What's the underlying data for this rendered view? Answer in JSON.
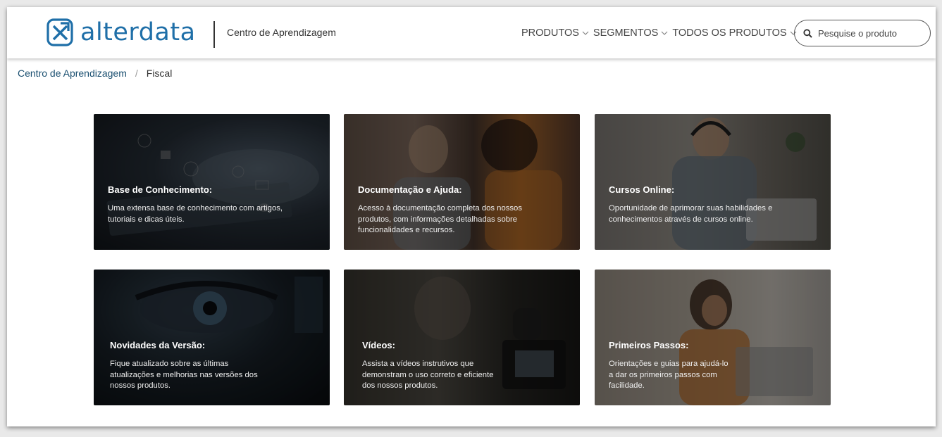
{
  "header": {
    "brand": "alterdata",
    "subtitle": "Centro de Aprendizagem",
    "nav": [
      {
        "label": "PRODUTOS"
      },
      {
        "label": "SEGMENTOS"
      },
      {
        "label": "TODOS OS PRODUTOS"
      }
    ],
    "search_placeholder": "Pesquise o produto"
  },
  "breadcrumb": {
    "parent": "Centro de Aprendizagem",
    "current": "Fiscal"
  },
  "cards": [
    {
      "title": "Base de Conhecimento:",
      "description": "Uma extensa base de conhecimento com artigos, tutoriais e dicas úteis."
    },
    {
      "title": "Documentação e Ajuda:",
      "description": "Acesso à documentação completa dos nossos produtos, com informações detalhadas sobre funcionalidades e recursos."
    },
    {
      "title": "Cursos Online:",
      "description": "Oportunidade de aprimorar suas habilidades e conhecimentos através de cursos online."
    },
    {
      "title": "Novidades da Versão:",
      "description": "Fique atualizado sobre as últimas atualizações e melhorias nas versões dos nossos produtos."
    },
    {
      "title": "Vídeos:",
      "description": "Assista a vídeos instrutivos que demonstram o uso correto e eficiente dos nossos produtos."
    },
    {
      "title": "Primeiros Passos:",
      "description": "Orientações e guias para ajudá-lo a dar os primeiros passos com facilidade."
    }
  ],
  "colors": {
    "brand": "#1f6fa8",
    "link": "#1a4f70"
  }
}
